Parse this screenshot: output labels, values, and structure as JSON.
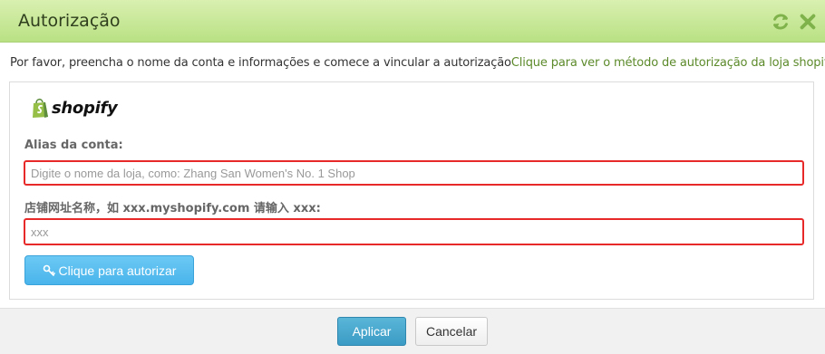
{
  "dialog": {
    "title": "Autorização",
    "refresh_icon": "refresh-icon",
    "close_icon": "close-icon",
    "accent_color": "#b9e184"
  },
  "intro": {
    "text": "Por favor, preencha o nome da conta e informações e comece a vincular a autorização",
    "link": "Clique para ver o método de autorização da loja shopify"
  },
  "panel": {
    "logo_icon": "shopify-bag-icon",
    "logo_text": "shopify",
    "alias_label": "Alias da conta:",
    "alias_placeholder": "Digite o nome da loja, como: Zhang San Women's No. 1 Shop",
    "store_label": "店铺网址名称，如 xxx.myshopify.com 请输入 xxx:",
    "store_placeholder": "xxx",
    "authorize_icon": "key-icon",
    "authorize_label": "Clique para autorizar"
  },
  "footer": {
    "apply_label": "Aplicar",
    "cancel_label": "Cancelar"
  }
}
